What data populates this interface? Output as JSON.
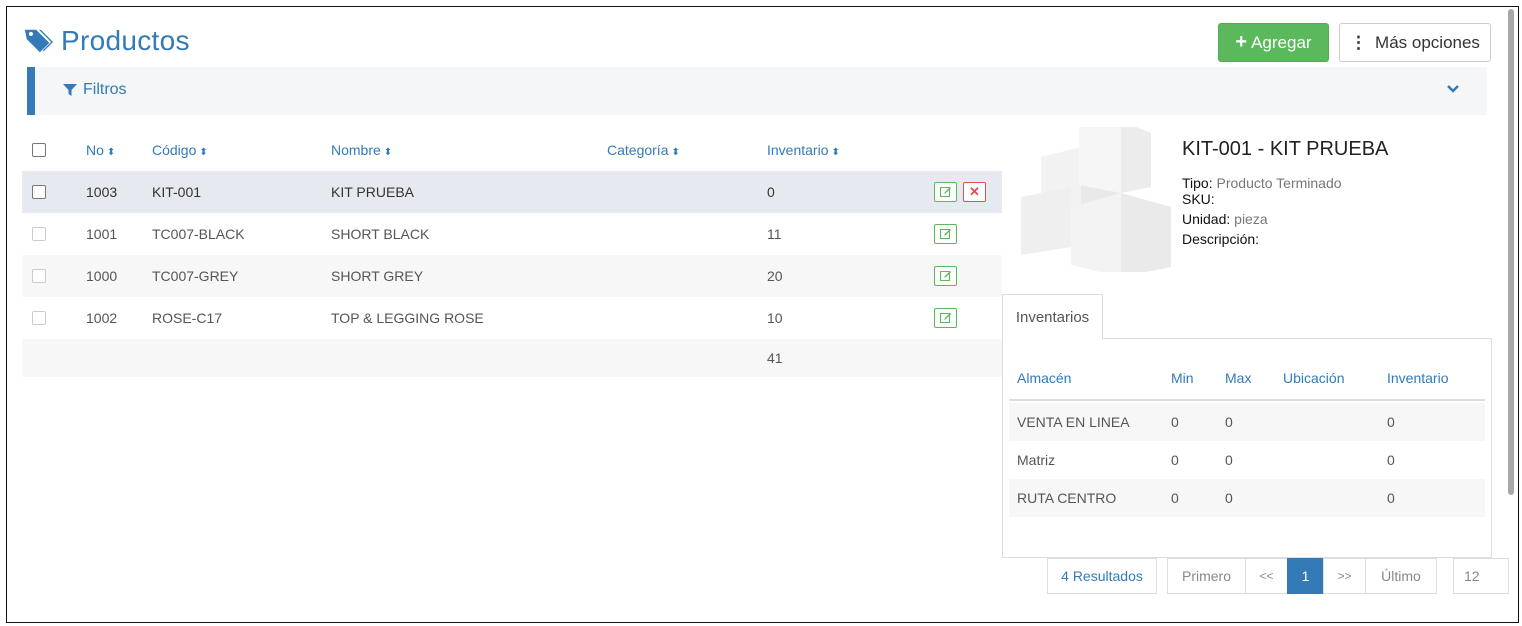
{
  "header": {
    "title": "Productos",
    "add_label": "Agregar",
    "more_label": "Más opciones"
  },
  "filters": {
    "label": "Filtros"
  },
  "table": {
    "columns": [
      "No",
      "Código",
      "Nombre",
      "Categoría",
      "Inventario"
    ],
    "rows": [
      {
        "no": "1003",
        "code": "KIT-001",
        "name": "KIT PRUEBA",
        "category": "",
        "inventory": "0"
      },
      {
        "no": "1001",
        "code": "TC007-BLACK",
        "name": "SHORT BLACK",
        "category": "",
        "inventory": "11"
      },
      {
        "no": "1000",
        "code": "TC007-GREY",
        "name": "SHORT GREY",
        "category": "",
        "inventory": "20"
      },
      {
        "no": "1002",
        "code": "ROSE-C17",
        "name": "TOP & LEGGING ROSE",
        "category": "",
        "inventory": "10"
      }
    ],
    "total_inventory": "41"
  },
  "detail": {
    "title": "KIT-001 - KIT PRUEBA",
    "tipo_label": "Tipo:",
    "tipo_value": "Producto Terminado",
    "sku_label": "SKU:",
    "sku_value": "",
    "unidad_label": "Unidad:",
    "unidad_value": "pieza",
    "descripcion_label": "Descripción:",
    "descripcion_value": "",
    "tab_label": "Inventarios",
    "inv_columns": [
      "Almacén",
      "Min",
      "Max",
      "Ubicación",
      "Inventario"
    ],
    "inv_rows": [
      {
        "almacen": "VENTA EN LINEA",
        "min": "0",
        "max": "0",
        "ubicacion": "",
        "inventario": "0"
      },
      {
        "almacen": "Matriz",
        "min": "0",
        "max": "0",
        "ubicacion": "",
        "inventario": "0"
      },
      {
        "almacen": "RUTA CENTRO",
        "min": "0",
        "max": "0",
        "ubicacion": "",
        "inventario": "0"
      }
    ]
  },
  "pagination": {
    "results": "4 Resultados",
    "first": "Primero",
    "prev": "<<",
    "current": "1",
    "next": ">>",
    "last": "Último",
    "page_size": "12"
  },
  "colors": {
    "primary": "#337ab7",
    "success": "#5cb85c",
    "danger": "#d9534f"
  },
  "icons": {
    "title": "tags-icon",
    "filter": "filter-icon",
    "collapse": "chevron-down-icon",
    "edit": "edit-icon",
    "delete": "delete-icon"
  }
}
